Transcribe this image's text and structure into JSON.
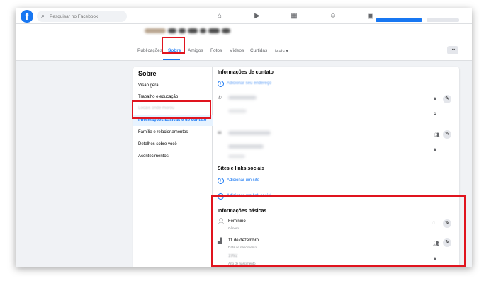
{
  "top_nav": {
    "logo_letter": "f",
    "search_placeholder": "Pesquisar no Facebook",
    "nav_icons": [
      "home-icon",
      "watch-icon",
      "marketplace-icon",
      "groups-icon",
      "gaming-icon"
    ]
  },
  "profile_tabs": {
    "items": [
      "Publicações",
      "Sobre",
      "Amigos",
      "Fotos",
      "Vídeos",
      "Curtidas",
      "Mais ▾"
    ],
    "active": "Sobre",
    "more_button": "···"
  },
  "sidebar": {
    "title": "Sobre",
    "items": [
      "Visão geral",
      "Trabalho e educação",
      "Locais onde morou",
      "Informações básicas e de contato",
      "Família e relacionamentos",
      "Detalhes sobre você",
      "Acontecimentos"
    ],
    "active_index": 3
  },
  "contact_section": {
    "title": "Informações de contato",
    "add_address": "Adicionar seu endereço"
  },
  "sites_section": {
    "title": "Sites e links sociais",
    "add_site": "Adicionar um site",
    "add_social_link": "Adicionar um link social"
  },
  "basic_info": {
    "title": "Informações básicas",
    "gender_value": "Feminino",
    "gender_label": "Gênero",
    "birth_date_value": "11 de dezembro",
    "birth_date_label": "Data de nascimento",
    "birth_year_value": "1992",
    "birth_year_label": "Ano de nascimento"
  },
  "colors": {
    "accent": "#1877f2",
    "highlight": "#e0141e",
    "background": "#f0f2f5"
  }
}
